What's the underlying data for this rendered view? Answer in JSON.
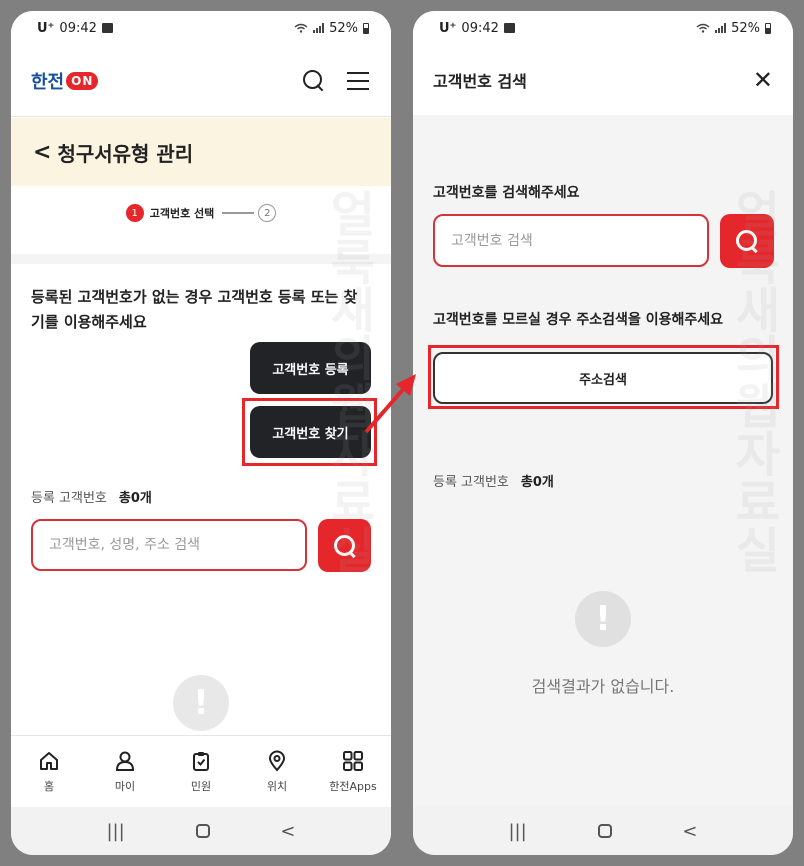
{
  "status_bar": {
    "carrier": "U⁺",
    "time": "09:42",
    "battery": "52%"
  },
  "left": {
    "logo_text": "한전",
    "logo_on": "ON",
    "page_title": "청구서유형 관리",
    "stepper": {
      "step1_num": "1",
      "step1_label": "고객번호 선택",
      "step2_num": "2"
    },
    "notice": "등록된 고객번호가 없는 경우 고객번호 등록 또는 찾기를 이용해주세요",
    "register_button": "고객번호 등록",
    "find_button": "고객번호 찾기",
    "count_label": "등록 고객번호",
    "count_value": "총0개",
    "search_placeholder": "고객번호, 성명, 주소 검색",
    "nav": [
      {
        "icon": "home-icon",
        "label": "홈"
      },
      {
        "icon": "user-icon",
        "label": "마이"
      },
      {
        "icon": "clipboard-icon",
        "label": "민원"
      },
      {
        "icon": "location-pin-icon",
        "label": "위치"
      },
      {
        "icon": "apps-grid-icon",
        "label": "한전Apps"
      }
    ]
  },
  "right": {
    "modal_title": "고객번호 검색",
    "search_label": "고객번호를 검색해주세요",
    "search_placeholder": "고객번호 검색",
    "address_label": "고객번호를 모르실 경우 주소검색을 이용해주세요",
    "address_button": "주소검색",
    "count_label": "등록 고객번호",
    "count_value": "총0개",
    "empty_message": "검색결과가 없습니다."
  },
  "watermark": "얼룩새의웹자료실",
  "colors": {
    "accent_red": "#e5262b",
    "dark_button": "#222326",
    "title_band": "#fbf4e1",
    "logo_blue": "#1a4fa0"
  }
}
